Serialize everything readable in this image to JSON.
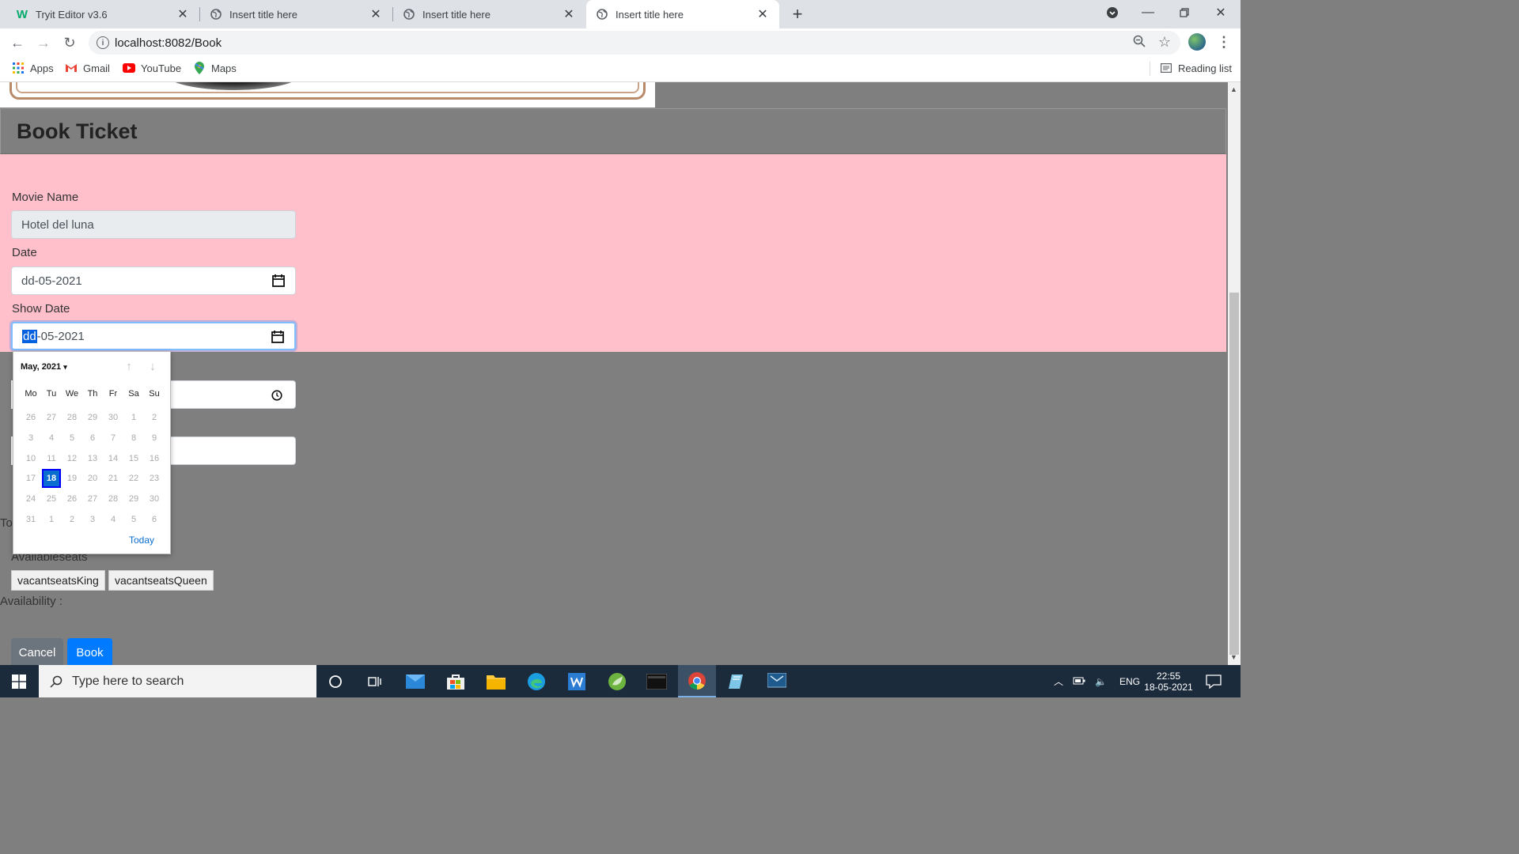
{
  "browser": {
    "tabs": [
      {
        "title": "Tryit Editor v3.6",
        "icon": "w3-logo-icon",
        "active": false
      },
      {
        "title": "Insert title here",
        "icon": "globe-icon",
        "active": false
      },
      {
        "title": "Insert title here",
        "icon": "globe-icon",
        "active": false
      },
      {
        "title": "Insert title here",
        "icon": "globe-icon",
        "active": true
      }
    ],
    "url": "localhost:8082/Book",
    "bookmarks": [
      {
        "label": "Apps",
        "icon": "apps-grid-icon"
      },
      {
        "label": "Gmail",
        "icon": "gmail-icon"
      },
      {
        "label": "YouTube",
        "icon": "youtube-icon"
      },
      {
        "label": "Maps",
        "icon": "maps-icon"
      }
    ],
    "reading_list": "Reading list"
  },
  "page": {
    "heading": "Book Ticket",
    "movie_name_label": "Movie Name",
    "movie_name_value": "Hotel del luna",
    "date_label": "Date",
    "date_value": "dd-05-2021",
    "show_date_label": "Show Date",
    "show_date_seg_selected": "dd",
    "show_date_rest": "-05-2021",
    "partial_label_to": "To",
    "available_seats_label": "Availableseats",
    "seat_buttons": [
      "vacantseatsKing",
      "vacantseatsQueen"
    ],
    "availability_label": "Availability :",
    "cancel_label": "Cancel",
    "book_label": "Book",
    "colors": {
      "pink": "#ffc0cb",
      "gray": "#7f7f7f",
      "primary": "#007bff",
      "secondary": "#6c757d"
    }
  },
  "datepicker": {
    "month_label": "May, 2021",
    "weekdays": [
      "Mo",
      "Tu",
      "We",
      "Th",
      "Fr",
      "Sa",
      "Su"
    ],
    "weeks": [
      [
        "26",
        "27",
        "28",
        "29",
        "30",
        "1",
        "2"
      ],
      [
        "3",
        "4",
        "5",
        "6",
        "7",
        "8",
        "9"
      ],
      [
        "10",
        "11",
        "12",
        "13",
        "14",
        "15",
        "16"
      ],
      [
        "17",
        "18",
        "19",
        "20",
        "21",
        "22",
        "23"
      ],
      [
        "24",
        "25",
        "26",
        "27",
        "28",
        "29",
        "30"
      ],
      [
        "31",
        "1",
        "2",
        "3",
        "4",
        "5",
        "6"
      ]
    ],
    "selected_day": "18",
    "today_label": "Today"
  },
  "taskbar": {
    "search_placeholder": "Type here to search",
    "language": "ENG",
    "time": "22:55",
    "date": "18-05-2021"
  }
}
